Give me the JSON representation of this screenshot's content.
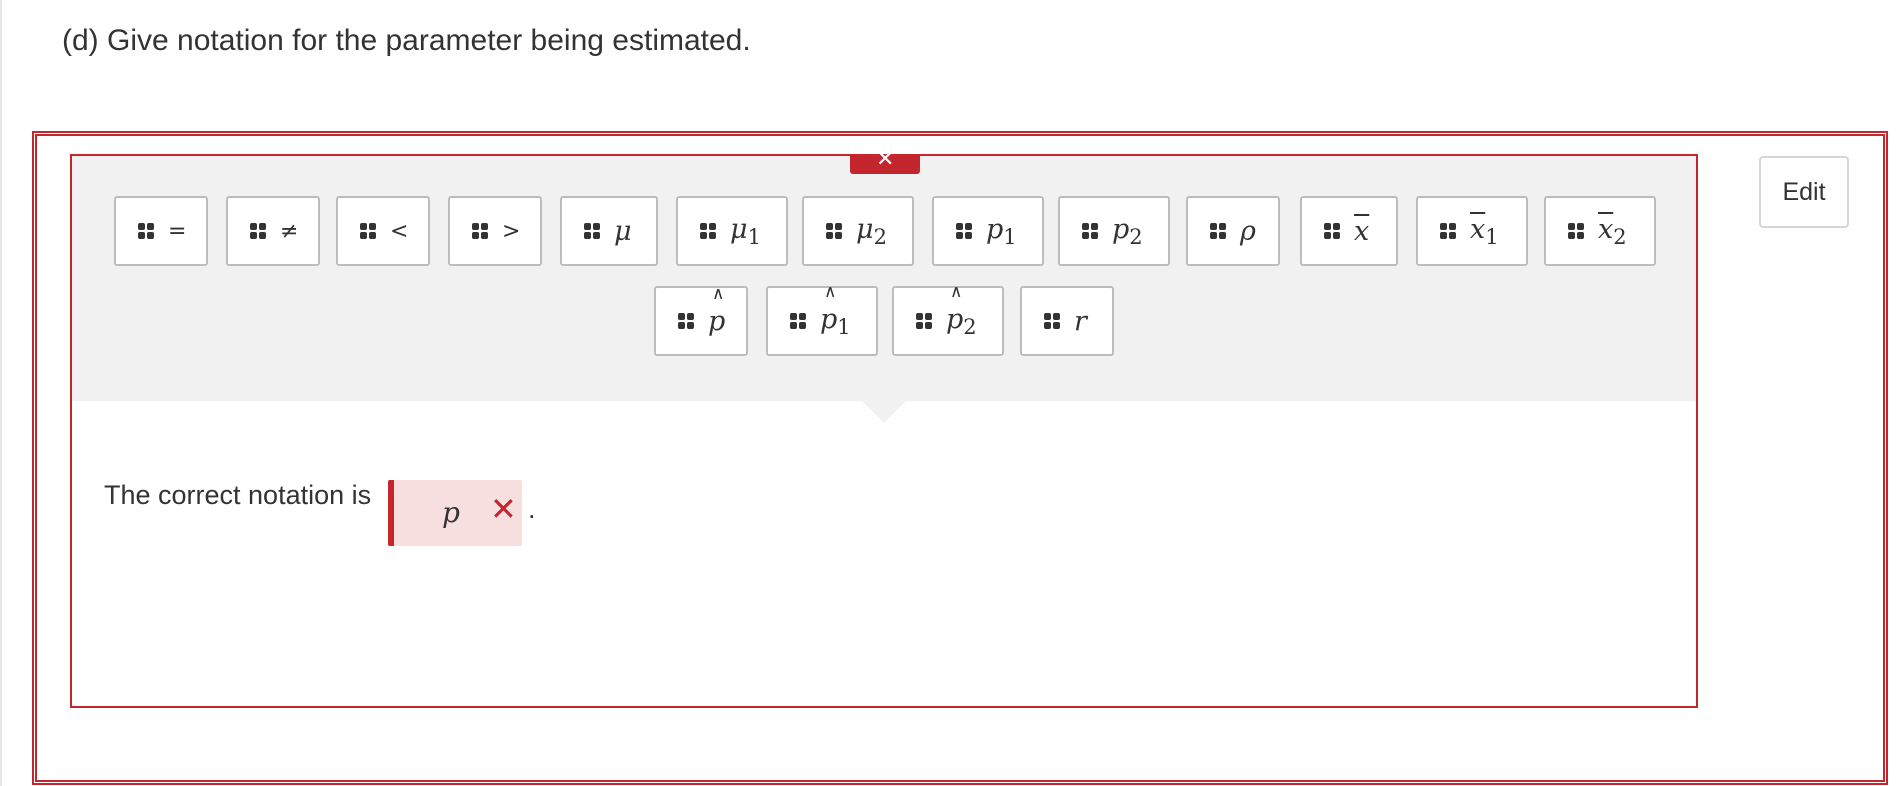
{
  "question": {
    "text": "(d) Give notation for the parameter being estimated."
  },
  "edit_button": {
    "label": "Edit"
  },
  "palette": {
    "close_label": "✕",
    "row1": [
      {
        "main": "=",
        "sub": "",
        "style": "plain"
      },
      {
        "main": "≠",
        "sub": "",
        "style": "plain"
      },
      {
        "main": "<",
        "sub": "",
        "style": "plain"
      },
      {
        "main": ">",
        "sub": "",
        "style": "plain"
      },
      {
        "main": "μ",
        "sub": "",
        "style": "italic"
      },
      {
        "main": "μ",
        "sub": "1",
        "style": "italic"
      },
      {
        "main": "μ",
        "sub": "2",
        "style": "italic"
      },
      {
        "main": "p",
        "sub": "1",
        "style": "italic"
      },
      {
        "main": "p",
        "sub": "2",
        "style": "italic"
      },
      {
        "main": "ρ",
        "sub": "",
        "style": "italic"
      },
      {
        "main": "x",
        "sub": "",
        "style": "bar"
      },
      {
        "main": "x",
        "sub": "1",
        "style": "bar"
      },
      {
        "main": "x",
        "sub": "2",
        "style": "bar"
      }
    ],
    "row2": [
      {
        "main": "p",
        "sub": "",
        "style": "hat",
        "hat": "∧"
      },
      {
        "main": "p",
        "sub": "1",
        "style": "hat",
        "hat": "∧"
      },
      {
        "main": "p",
        "sub": "2",
        "style": "hat",
        "hat": "∧"
      },
      {
        "main": "r",
        "sub": "",
        "style": "italic"
      }
    ]
  },
  "answer": {
    "prefix": "The correct notation is",
    "value": "p",
    "status_icon": "✕",
    "suffix": "."
  },
  "colors": {
    "error_red": "#c4262e",
    "drop_zone_bg": "#f7dfe0",
    "palette_bg": "#f1f1f1"
  }
}
